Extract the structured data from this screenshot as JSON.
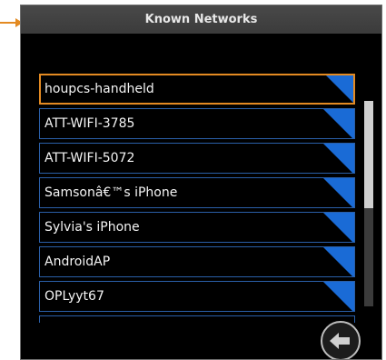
{
  "window": {
    "title": "Known Networks"
  },
  "networks": [
    {
      "label": "houpcs-handheld",
      "selected": true
    },
    {
      "label": "ATT-WIFI-3785",
      "selected": false
    },
    {
      "label": "ATT-WIFI-5072",
      "selected": false
    },
    {
      "label": "Samsonâ€™s iPhone",
      "selected": false
    },
    {
      "label": "Sylvia's iPhone",
      "selected": false
    },
    {
      "label": "AndroidAP",
      "selected": false
    },
    {
      "label": "OPLyyt67",
      "selected": false
    }
  ],
  "icons": {
    "pointer": "orange-arrow-icon",
    "corner": "blue-corner-triangle-icon",
    "back": "left-arrow-icon"
  },
  "colors": {
    "selected_border": "#e38a22",
    "item_border": "#2a5fa8",
    "corner_fill": "#1a6bd6",
    "background": "#000000"
  }
}
